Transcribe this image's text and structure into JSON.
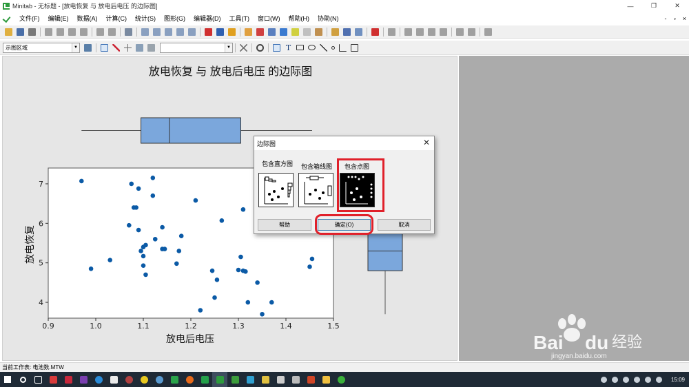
{
  "window": {
    "app_name": "Minitab",
    "title": "Minitab - 无标题 - [放电恢复 与 放电后电压 的边际图]",
    "minimize": "—",
    "restore": "❐",
    "close": "✕"
  },
  "menu": {
    "items": [
      "文件(F)",
      "编辑(E)",
      "数据(A)",
      "计算(C)",
      "统计(S)",
      "图形(G)",
      "编辑器(D)",
      "工具(T)",
      "窗口(W)",
      "帮助(H)",
      "协助(N)"
    ],
    "mdi_minimize": "-",
    "mdi_restore": "▫",
    "mdi_close": "×"
  },
  "toolbar2": {
    "region_combo": "示图区域",
    "text_combo": ""
  },
  "graph": {
    "title": "放电恢复 与 放电后电压 的边际图",
    "xlabel": "放电后电压",
    "ylabel": "放电恢复",
    "marker_color": "#0b5aa6",
    "box_fill": "#7ba7dc"
  },
  "chart_data": {
    "type": "scatter",
    "title": "放电恢复 与 放电后电压 的边际图",
    "xlabel": "放电后电压",
    "ylabel": "放电恢复",
    "xlim": [
      0.9,
      1.5
    ],
    "ylim": [
      3.6,
      7.4
    ],
    "xticks": [
      "0.9",
      "1.0",
      "1.1",
      "1.2",
      "1.3",
      "1.4",
      "1.5"
    ],
    "yticks": [
      "4",
      "5",
      "6",
      "7"
    ],
    "x": [
      0.97,
      0.99,
      1.03,
      1.07,
      1.075,
      1.08,
      1.085,
      1.09,
      1.09,
      1.095,
      1.1,
      1.1,
      1.1,
      1.105,
      1.105,
      1.12,
      1.12,
      1.125,
      1.14,
      1.14,
      1.145,
      1.17,
      1.175,
      1.18,
      1.21,
      1.22,
      1.245,
      1.25,
      1.255,
      1.265,
      1.3,
      1.305,
      1.31,
      1.31,
      1.315,
      1.32,
      1.34,
      1.35,
      1.37,
      1.45,
      1.455
    ],
    "y": [
      7.07,
      4.85,
      5.07,
      5.95,
      7.0,
      6.4,
      6.4,
      5.83,
      6.88,
      5.3,
      4.93,
      5.17,
      5.4,
      4.7,
      5.45,
      7.15,
      6.7,
      5.6,
      5.35,
      5.9,
      5.35,
      4.98,
      5.3,
      5.68,
      6.58,
      3.8,
      4.8,
      4.12,
      4.57,
      6.07,
      4.82,
      5.15,
      6.35,
      4.8,
      4.78,
      4.0,
      4.5,
      3.7,
      4.0,
      4.9,
      5.1
    ],
    "x_box": {
      "min": 0.97,
      "q1": 1.095,
      "median": 1.155,
      "q3": 1.305,
      "max": 1.455
    },
    "y_box": {
      "min": 3.7,
      "q1": 4.8,
      "median": 5.3,
      "q3": 6.07,
      "max": 7.15
    },
    "grid": false
  },
  "dialog": {
    "title": "边际图",
    "close": "✕",
    "options": [
      "包含直方图",
      "包含箱线图",
      "包含点图"
    ],
    "selected_option": "包含点图",
    "help_button": "帮助",
    "ok_button": "确定(O)",
    "cancel_button": "取消",
    "highlight_color": "#e0202a"
  },
  "status": {
    "worksheet": "当前工作表: 电池数.MTW"
  },
  "taskbar": {
    "time": "15:09"
  },
  "watermark": {
    "brand": "Bai",
    "brand2": "du",
    "cn": "经验",
    "url": "jingyan.baidu.com"
  }
}
